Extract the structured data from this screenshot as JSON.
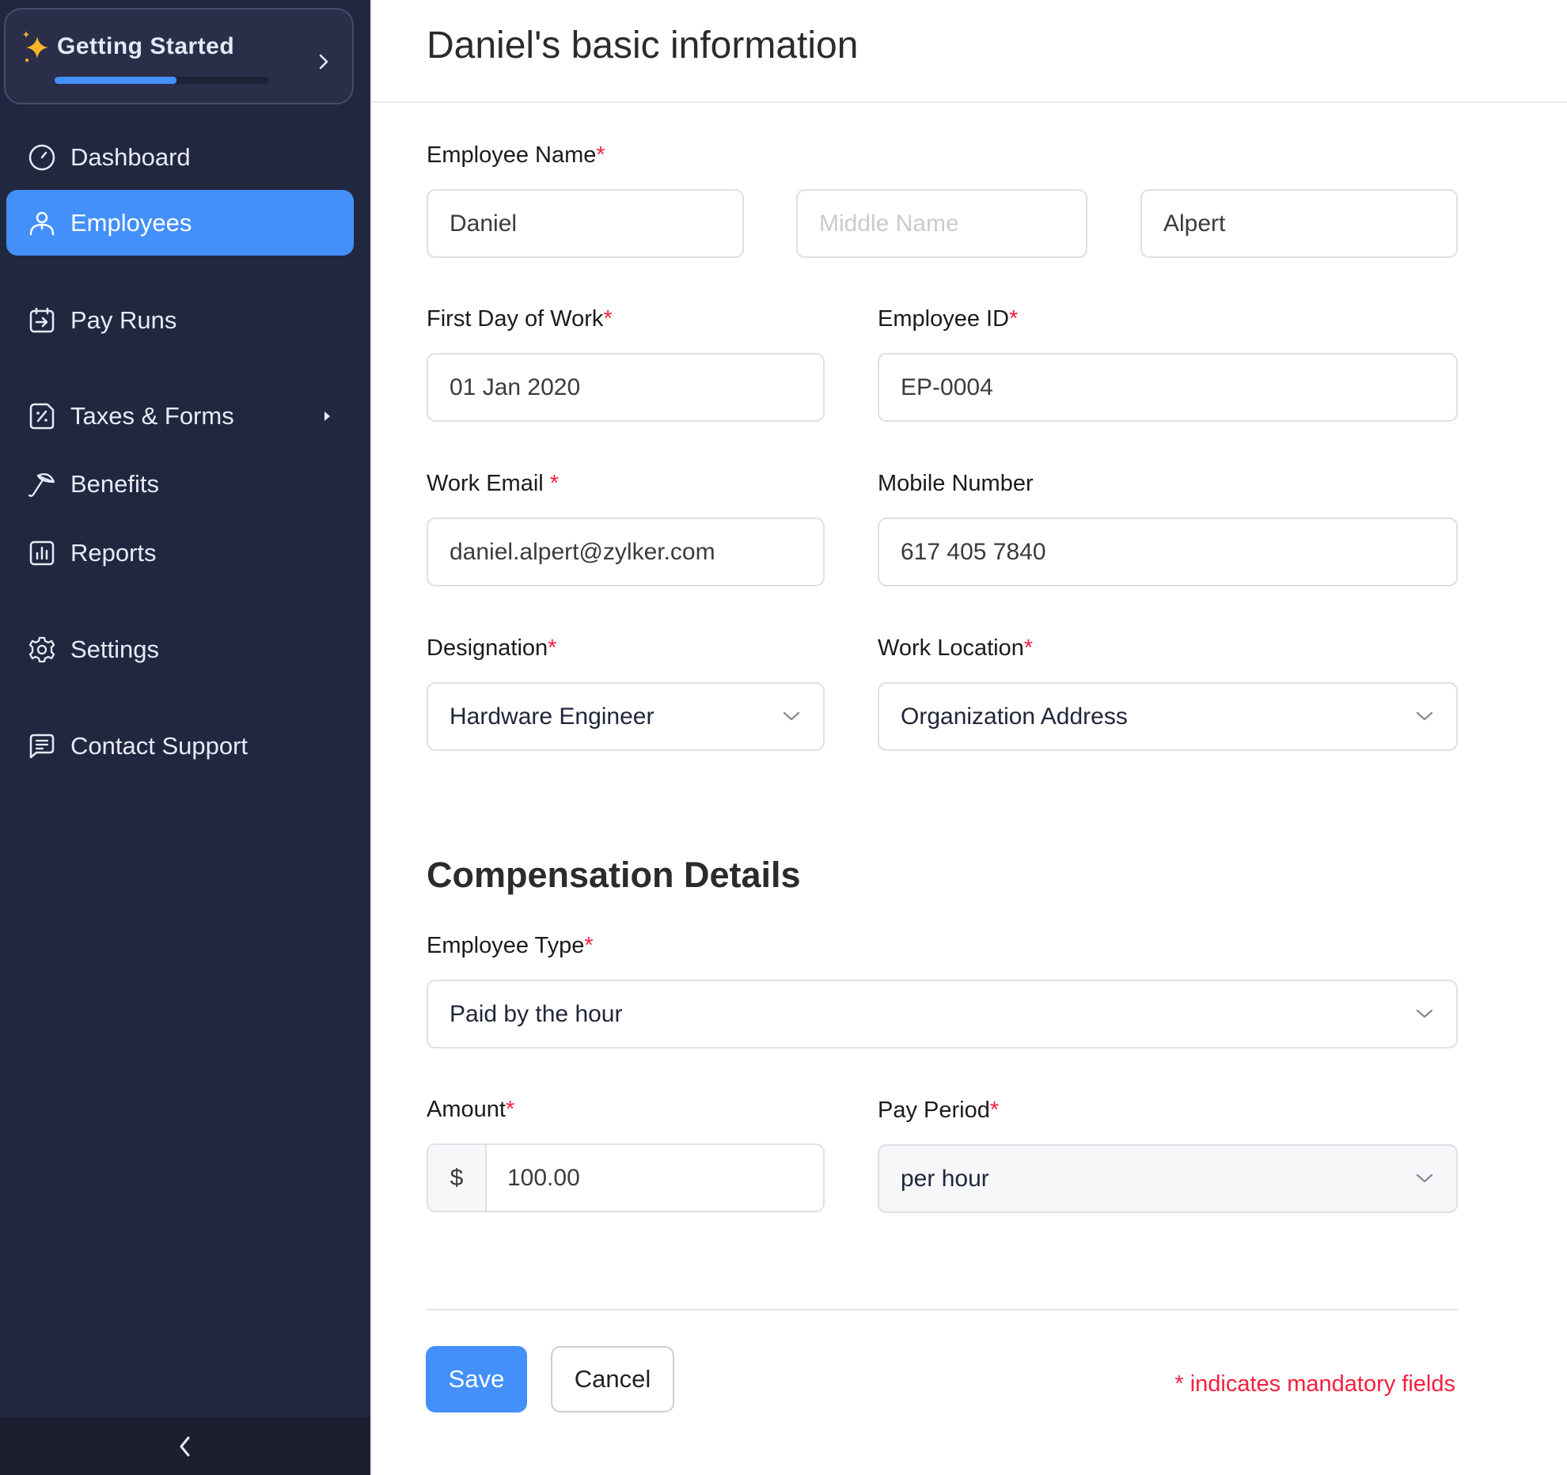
{
  "sidebar": {
    "getting_started": {
      "title": "Getting Started",
      "progress": 0.57,
      "icon": "sparkle-icon"
    },
    "items": [
      {
        "label": "Dashboard",
        "icon": "dashboard-gauge-icon",
        "active": false
      },
      {
        "label": "Employees",
        "icon": "person-icon",
        "active": true
      },
      {
        "label": "Pay Runs",
        "icon": "calendar-arrow-icon",
        "active": false
      },
      {
        "label": "Taxes & Forms",
        "icon": "percent-document-icon",
        "active": false,
        "has_submenu": true
      },
      {
        "label": "Benefits",
        "icon": "umbrella-icon",
        "active": false
      },
      {
        "label": "Reports",
        "icon": "bar-chart-icon",
        "active": false
      },
      {
        "label": "Settings",
        "icon": "gear-icon",
        "active": false
      },
      {
        "label": "Contact Support",
        "icon": "chat-icon",
        "active": false
      }
    ],
    "collapse_icon": "chevron-left-icon"
  },
  "colors": {
    "sidebar_bg": "#222740",
    "accent": "#4390fb",
    "required": "#f5203f",
    "star": "#fbb627"
  },
  "page": {
    "title": "Daniel's basic information"
  },
  "form": {
    "employee_name": {
      "label": "Employee Name",
      "required_mark": "*",
      "first_name": "Daniel",
      "middle_name_placeholder": "Middle Name",
      "last_name": "Alpert"
    },
    "first_day": {
      "label": "First Day of Work",
      "required_mark": "*",
      "value": "01 Jan 2020"
    },
    "employee_id": {
      "label": "Employee ID",
      "required_mark": "*",
      "value": "EP-0004"
    },
    "work_email": {
      "label": "Work Email",
      "required_mark": "*",
      "value": "daniel.alpert@zylker.com"
    },
    "mobile": {
      "label": "Mobile Number",
      "value": "617 405 7840"
    },
    "designation": {
      "label": "Designation",
      "required_mark": "*",
      "value": "Hardware Engineer"
    },
    "work_location": {
      "label": "Work Location",
      "required_mark": "*",
      "value": "Organization Address"
    }
  },
  "compensation": {
    "title": "Compensation Details",
    "employee_type": {
      "label": "Employee Type",
      "required_mark": "*",
      "value": "Paid by the hour"
    },
    "amount": {
      "label": "Amount",
      "required_mark": "*",
      "currency": "$",
      "value": "100.00"
    },
    "pay_period": {
      "label": "Pay Period",
      "required_mark": "*",
      "value": "per hour"
    }
  },
  "footer": {
    "save_label": "Save",
    "cancel_label": "Cancel",
    "mandatory_note": "* indicates mandatory fields"
  }
}
